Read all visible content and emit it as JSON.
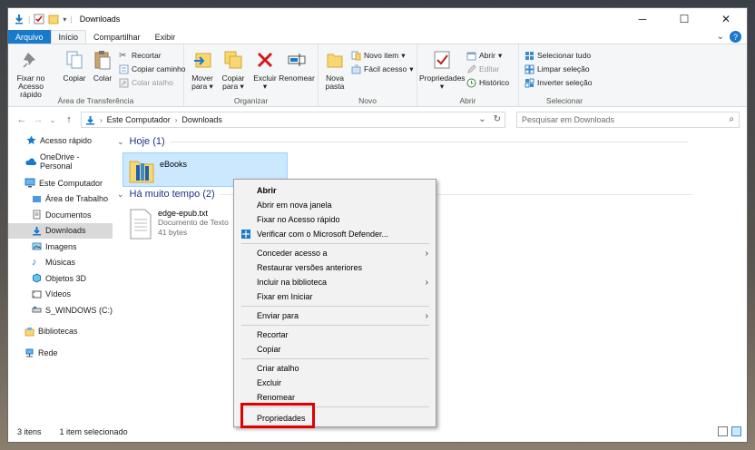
{
  "window": {
    "title": "Downloads"
  },
  "tabs": [
    "Arquivo",
    "Início",
    "Compartilhar",
    "Exibir"
  ],
  "ribbon": {
    "clipboard": {
      "pin_label": "Fixar no Acesso rápido",
      "copy_label": "Copiar",
      "paste_label": "Colar",
      "cut_label": "Recortar",
      "copy_path_label": "Copiar caminho",
      "paste_shortcut_label": "Colar atalho",
      "group_label": "Área de Transferência"
    },
    "organize": {
      "move_label": "Mover para",
      "copy_to_label": "Copiar para",
      "delete_label": "Excluir",
      "rename_label": "Renomear",
      "group_label": "Organizar"
    },
    "new": {
      "new_folder_label": "Nova pasta",
      "new_item_label": "Novo item",
      "easy_access_label": "Fácil acesso",
      "group_label": "Novo"
    },
    "open": {
      "properties_label": "Propriedades",
      "open_label": "Abrir",
      "edit_label": "Editar",
      "history_label": "Histórico",
      "group_label": "Abrir"
    },
    "select": {
      "select_all_label": "Selecionar tudo",
      "select_none_label": "Limpar seleção",
      "invert_label": "Inverter seleção",
      "group_label": "Selecionar"
    }
  },
  "address": {
    "crumbs": [
      "Este Computador",
      "Downloads"
    ]
  },
  "search": {
    "placeholder": "Pesquisar em Downloads"
  },
  "nav": {
    "quick_access": "Acesso rápido",
    "onedrive": "OneDrive - Personal",
    "this_pc": "Este Computador",
    "desktop": "Área de Trabalho",
    "documents": "Documentos",
    "downloads": "Downloads",
    "images": "Imagens",
    "music": "Músicas",
    "objects3d": "Objetos 3D",
    "videos": "Vídeos",
    "drive_c": "S_WINDOWS (C:)",
    "libraries": "Bibliotecas",
    "network": "Rede"
  },
  "content": {
    "group_today": "Hoje (1)",
    "group_old": "Há muito tempo (2)",
    "folder_name": "eBooks",
    "file_name": "edge-epub.txt",
    "file_type": "Documento de Texto",
    "file_size": "41 bytes"
  },
  "context_menu": {
    "open": "Abrir",
    "open_new_window": "Abrir em nova janela",
    "pin_quick": "Fixar no Acesso rápido",
    "defender": "Verificar com o Microsoft Defender...",
    "give_access": "Conceder acesso a",
    "restore_versions": "Restaurar versões anteriores",
    "include_library": "Incluir na biblioteca",
    "pin_start": "Fixar em Iniciar",
    "send_to": "Enviar para",
    "cut": "Recortar",
    "copy": "Copiar",
    "create_shortcut": "Criar atalho",
    "delete": "Excluir",
    "rename": "Renomear",
    "properties": "Propriedades"
  },
  "status": {
    "items": "3 itens",
    "selected": "1 item selecionado"
  },
  "colors": {
    "accent": "#1979ca",
    "selection": "#cce8ff",
    "highlight": "#e00000",
    "group_header": "#1e3287"
  }
}
